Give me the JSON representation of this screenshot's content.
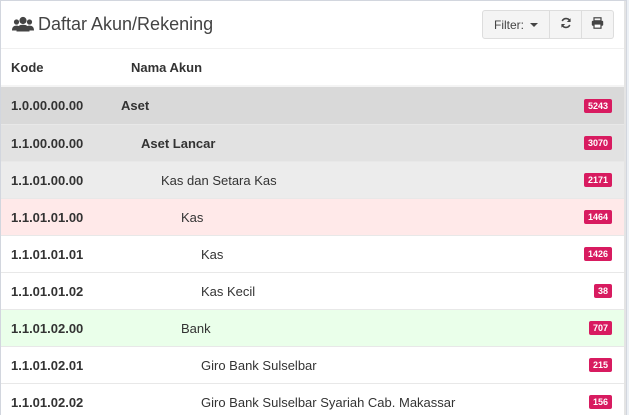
{
  "header": {
    "title": "Daftar Akun/Rekening",
    "filter_label": "Filter:",
    "icons": [
      "users-icon",
      "refresh-icon",
      "print-icon"
    ]
  },
  "table": {
    "columns": [
      "Kode",
      "Nama Akun"
    ],
    "rows": [
      {
        "kode": "1.0.00.00.00",
        "nama": "Aset",
        "count": "5243",
        "level": 0,
        "bg": "#d9d9d9",
        "bold": true
      },
      {
        "kode": "1.1.00.00.00",
        "nama": "Aset Lancar",
        "count": "3070",
        "level": 1,
        "bg": "#e2e2e2",
        "bold": true
      },
      {
        "kode": "1.1.01.00.00",
        "nama": "Kas dan Setara Kas",
        "count": "2171",
        "level": 2,
        "bg": "#ececec",
        "bold": false
      },
      {
        "kode": "1.1.01.01.00",
        "nama": "Kas",
        "count": "1464",
        "level": 3,
        "bg": "#ffe9e9",
        "bold": false
      },
      {
        "kode": "1.1.01.01.01",
        "nama": "Kas",
        "count": "1426",
        "level": 4,
        "bg": "#ffffff",
        "bold": false
      },
      {
        "kode": "1.1.01.01.02",
        "nama": "Kas Kecil",
        "count": "38",
        "level": 4,
        "bg": "#ffffff",
        "bold": false
      },
      {
        "kode": "1.1.01.02.00",
        "nama": "Bank",
        "count": "707",
        "level": 3,
        "bg": "#eaffea",
        "bold": false
      },
      {
        "kode": "1.1.01.02.01",
        "nama": "Giro Bank Sulselbar",
        "count": "215",
        "level": 4,
        "bg": "#ffffff",
        "bold": false
      },
      {
        "kode": "1.1.01.02.02",
        "nama": "Giro Bank Sulselbar Syariah Cab. Makassar",
        "count": "156",
        "level": 4,
        "bg": "#ffffff",
        "bold": false
      }
    ]
  },
  "colors": {
    "badge": "#d81b60"
  }
}
